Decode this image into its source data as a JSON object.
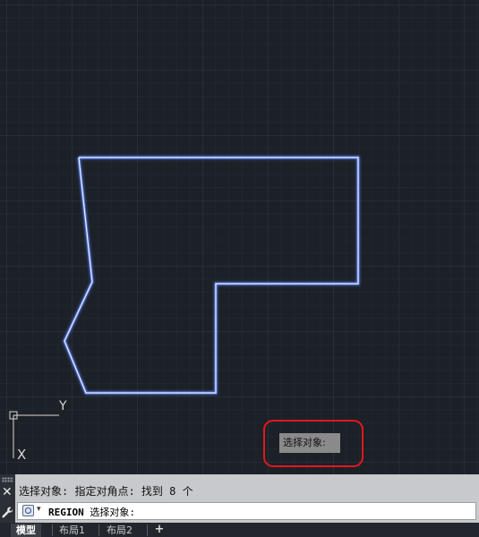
{
  "tooltip": {
    "text": "选择对象:"
  },
  "command_line": {
    "history": "选择对象: 指定对角点: 找到 8 个",
    "command": "REGION",
    "prompt": "选择对象:"
  },
  "tabs": [
    {
      "label": "模型"
    },
    {
      "label": "布局1"
    },
    {
      "label": "布局2"
    }
  ],
  "ucs": {
    "y_label": "Y",
    "x_label": "X"
  },
  "colors": {
    "background": "#1c2027",
    "grid": "#2c323b",
    "shape": "#9db8ff",
    "highlight": "#e2181c"
  }
}
